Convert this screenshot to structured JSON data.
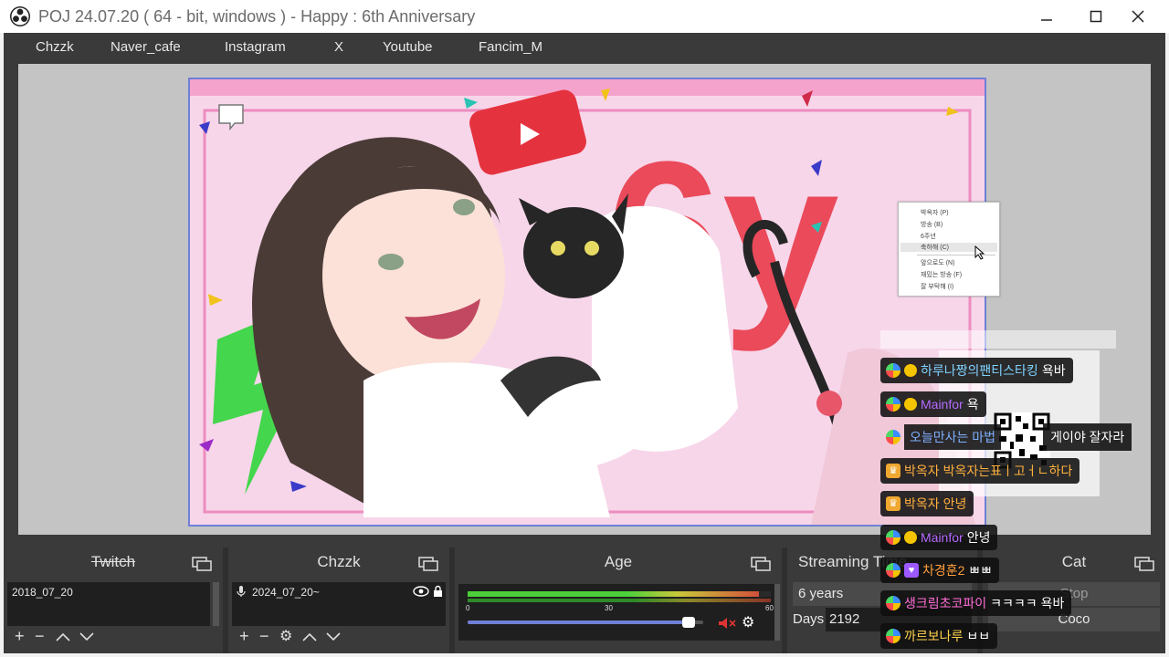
{
  "window": {
    "title": "POJ 24.07.20 ( 64 - bit, windows ) - Happy : 6th Anniversary"
  },
  "menu": [
    "Chzzk",
    "Naver_cafe",
    "Instagram",
    "X",
    "Youtube",
    "Fancim_M"
  ],
  "context_menu": [
    "박옥자 (P)",
    "방송 (B)",
    "6주년",
    "축하해 (C)",
    "앞으로도 (N)",
    "재밌는 방송 (F)",
    "잘 부탁해 (I)"
  ],
  "canvas": {
    "big_text": "6y"
  },
  "docks": {
    "twitch": {
      "title": "Twitch",
      "item": "2018_07_20"
    },
    "chzzk": {
      "title": "Chzzk",
      "item": "2024_07_20~"
    },
    "age": {
      "title": "Age",
      "ticks": [
        "0",
        "30",
        "60"
      ],
      "meter_level": 0.96,
      "slider_level": 0.95
    },
    "streaming": {
      "title": "Streaming Time",
      "years": "6 years",
      "days_label": "Days",
      "days_value": "2192"
    },
    "cat": {
      "title": "Cat",
      "stop": "Stop",
      "name": "Coco"
    }
  },
  "chat": [
    {
      "name": "하루나짱의팬티스타킹",
      "msg": "욕바",
      "color": "#7fd3ff"
    },
    {
      "name": "Mainfor",
      "msg": "욕",
      "color": "#b46bff"
    },
    {
      "name": "오늘만사는 마법",
      "msg": "게이야 잘자라",
      "color": "#7fb0ff"
    },
    {
      "name": "박옥자",
      "msg": "박옥자는표ㅣ고ㅓㄴ하다",
      "color": "#ffb13d"
    },
    {
      "name": "박옥자",
      "msg": "안녕",
      "color": "#ffb13d"
    },
    {
      "name": "Mainfor",
      "msg": "안녕",
      "color": "#b46bff"
    },
    {
      "name": "차경훈2",
      "msg": "ㅃㅃ",
      "color": "#ff9f3d"
    },
    {
      "name": "생크림초코파이",
      "msg": "ㅋㅋㅋㅋ 욕바",
      "color": "#ff6bd6"
    },
    {
      "name": "까르보나루",
      "msg": "ㅂㅂ",
      "color": "#ffd24d"
    }
  ],
  "colors": {
    "accent": "#6f7fd8",
    "dock_bg": "#3a3a3a",
    "chat_bg": "#0f0f0f"
  }
}
